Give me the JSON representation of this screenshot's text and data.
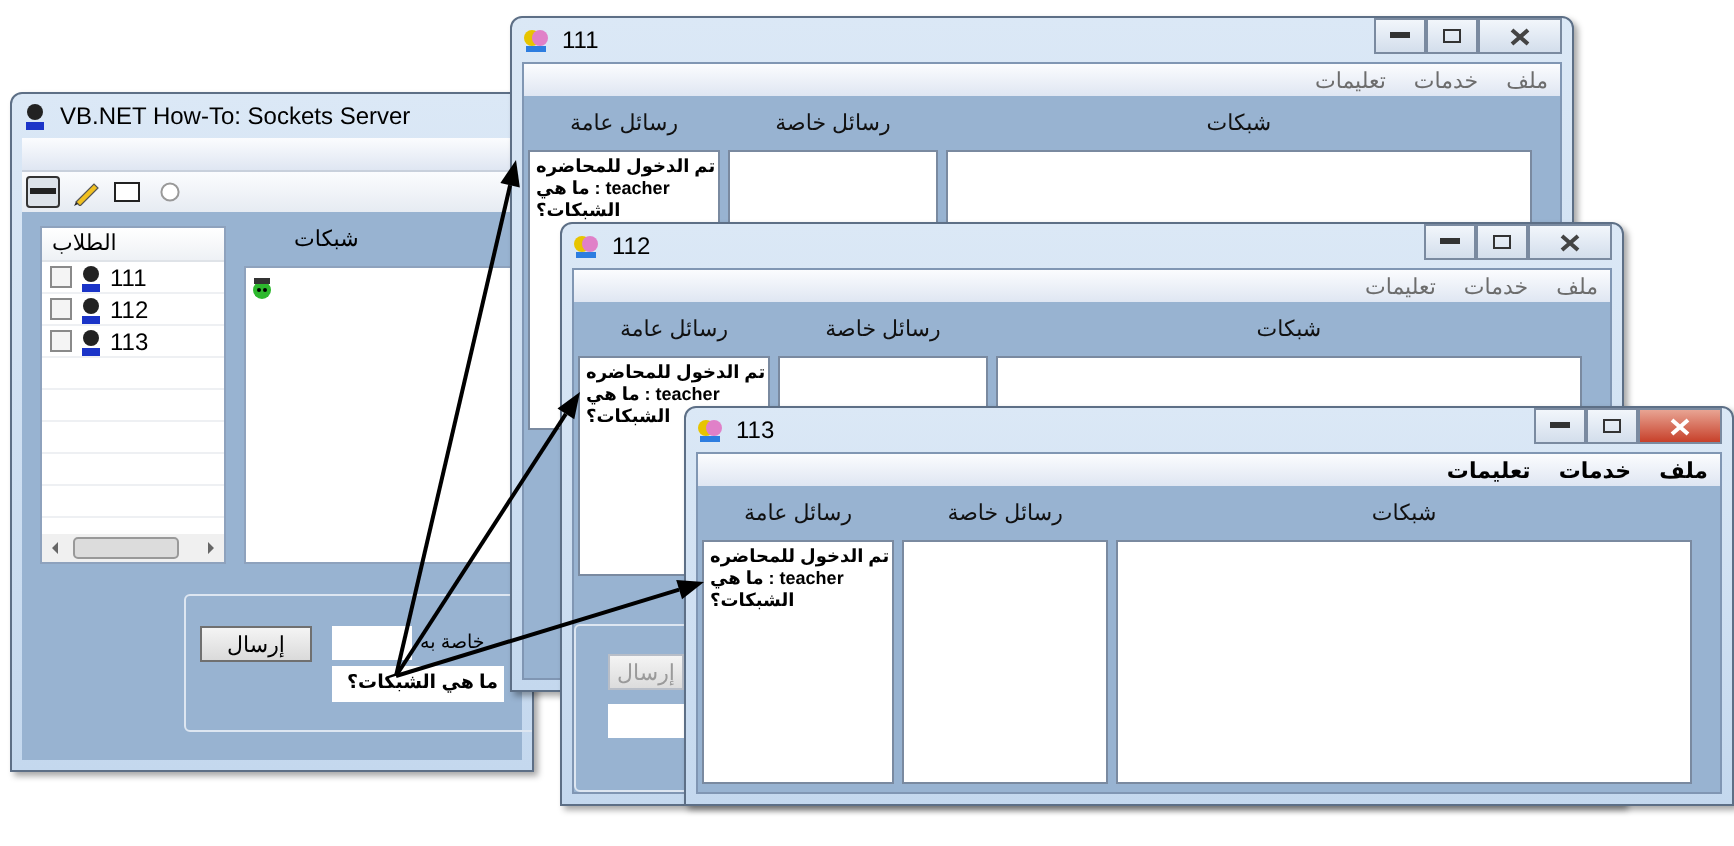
{
  "server": {
    "title": "VB.NET How-To: Sockets Server",
    "tools": [
      {
        "kind": "line",
        "selected": true
      },
      {
        "kind": "pencil",
        "selected": false
      },
      {
        "kind": "rectangle",
        "selected": false
      },
      {
        "kind": "ellipse",
        "selected": false
      }
    ],
    "students": {
      "header": "الطلاب",
      "items": [
        {
          "name": "111",
          "checked": false
        },
        {
          "name": "112",
          "checked": false
        },
        {
          "name": "113",
          "checked": false
        }
      ]
    },
    "networks_label": "شبكات",
    "send_button": "إرسال",
    "private_label": "خاصة به",
    "message_value": "ما هي الشبكات؟"
  },
  "clients": [
    {
      "title": "111",
      "active": false,
      "menu": [
        "ملف",
        "خدمات",
        "تعليمات"
      ],
      "columns": [
        "شبكات",
        "رسائل خاصة",
        "رسائل عامة"
      ],
      "messages": [
        "تم الدخول للمحاضره",
        "teacher : ما هي الشبكات؟"
      ]
    },
    {
      "title": "112",
      "active": false,
      "menu": [
        "ملف",
        "خدمات",
        "تعليمات"
      ],
      "columns": [
        "شبكات",
        "رسائل خاصة",
        "رسائل عامة"
      ],
      "messages": [
        "تم الدخول للمحاضره",
        "teacher : ما هي الشبكات؟"
      ],
      "send_button": {
        "label": "إرسال",
        "disabled": true
      }
    },
    {
      "title": "113",
      "active": true,
      "menu": [
        "ملف",
        "خدمات",
        "تعليمات"
      ],
      "columns": [
        "شبكات",
        "رسائل خاصة",
        "رسائل عامة"
      ],
      "messages": [
        "تم الدخول للمحاضره",
        "teacher : ما هي الشبكات؟"
      ]
    }
  ]
}
